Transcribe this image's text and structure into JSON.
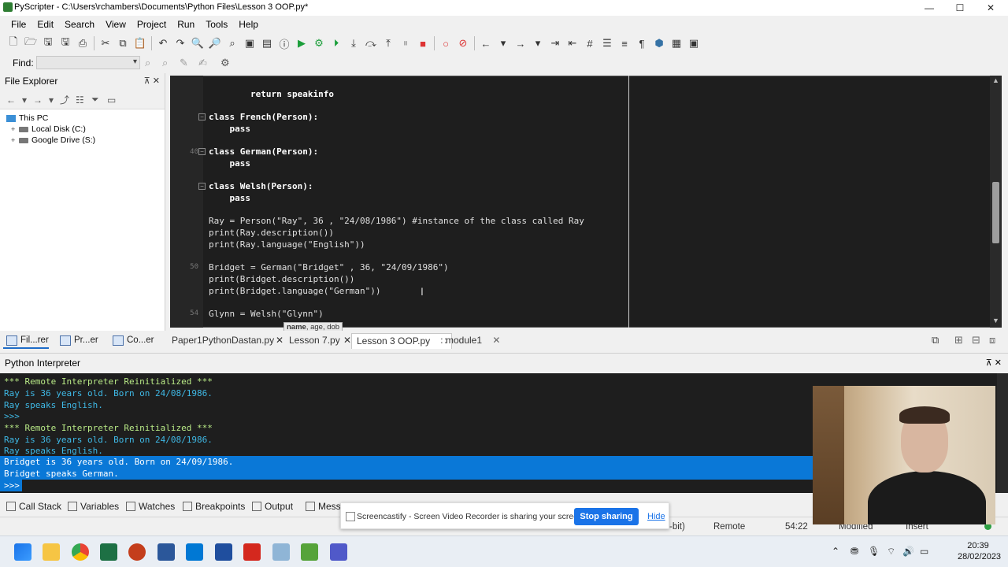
{
  "window": {
    "title": "PyScripter - C:\\Users\\rchambers\\Documents\\Python Files\\Lesson 3 OOP.py*",
    "min": "—",
    "max": "☐",
    "close": "✕"
  },
  "menu": [
    "File",
    "Edit",
    "Search",
    "View",
    "Project",
    "Run",
    "Tools",
    "Help"
  ],
  "find": {
    "label": "Find:",
    "value": ""
  },
  "explorer": {
    "title": "File Explorer",
    "pin": "⊼ ✕",
    "tree": [
      {
        "label": "This PC"
      },
      {
        "label": "Local Disk (C:)"
      },
      {
        "label": "Google Drive (S:)"
      }
    ]
  },
  "editor": {
    "line_numbers": [
      "40",
      "50",
      "54"
    ],
    "lines": [
      {
        "t": "        return speakinfo"
      },
      {
        "t": "class French(Person):"
      },
      {
        "t": "    pass"
      },
      {
        "t": "class German(Person):"
      },
      {
        "t": "    pass"
      },
      {
        "t": "class Welsh(Person):"
      },
      {
        "t": "    pass"
      },
      {
        "t": "Ray = Person(\"Ray\", 36 , \"24/08/1986\") #instance of the class called Ray"
      },
      {
        "t": "print(Ray.description())"
      },
      {
        "t": "print(Ray.language(\"English\"))"
      },
      {
        "t": "Bridget = German(\"Bridget\" , 36, \"24/09/1986\")"
      },
      {
        "t": "print(Bridget.description())"
      },
      {
        "t": "print(Bridget.language(\"German\"))"
      },
      {
        "t": "Glynn = Welsh(\"Glynn\")"
      }
    ],
    "hint": {
      "bold": "name",
      "rest": ", age, dob"
    }
  },
  "panel_tabs": [
    "Fil...rer",
    "Pr...er",
    "Co...er"
  ],
  "editor_tabs": [
    {
      "label": "Paper1PythonDastan.py"
    },
    {
      "label": "Lesson 7.py"
    },
    {
      "label": "Lesson 3 OOP.py"
    },
    {
      "label": "module1"
    }
  ],
  "interpreter": {
    "title": "Python Interpreter",
    "lines": [
      "*** Remote Interpreter Reinitialized ***",
      "Ray is 36 years old. Born on 24/08/1986.",
      "Ray speaks English.",
      ">>>",
      "*** Remote Interpreter Reinitialized ***",
      "Ray is 36 years old. Born on 24/08/1986.",
      "Ray speaks English.",
      "Bridget is 36 years old. Born on 24/09/1986.",
      "Bridget speaks German.",
      ">>>"
    ]
  },
  "bottom_tabs": [
    "Call Stack",
    "Variables",
    "Watches",
    "Breakpoints",
    "Output",
    "Mess"
  ],
  "status": {
    "bits": "-bit)",
    "remote": "Remote",
    "pos": "54:22",
    "modified": "Modified",
    "insert": "Insert"
  },
  "banner": {
    "text": "Screencastify - Screen Video Recorder is sharing your screen.",
    "stop": "Stop sharing",
    "hide": "Hide"
  },
  "clock": {
    "time": "20:39",
    "date": "28/02/2023"
  },
  "colors": {
    "editor_bg": "#1e1e1e",
    "console_green": "#b8e986",
    "console_cyan": "#3fb9e6",
    "selection": "#0a78d7",
    "banner_button": "#1a73e8"
  }
}
